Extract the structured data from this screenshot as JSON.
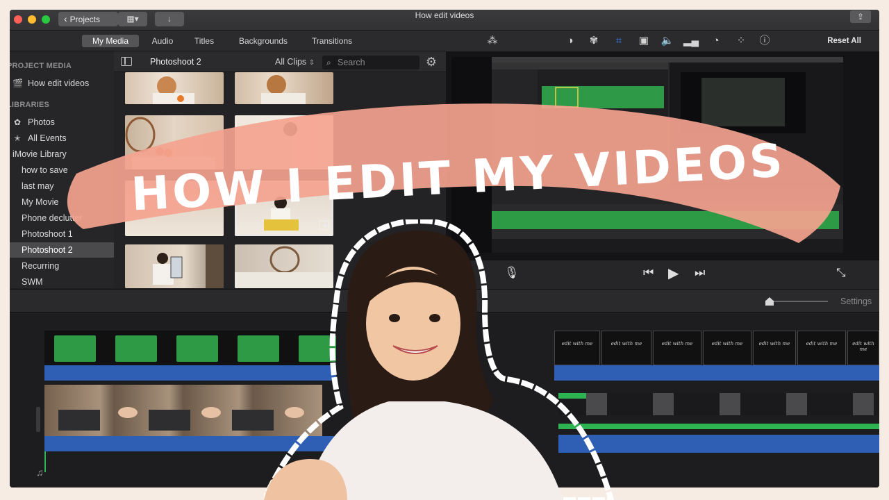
{
  "window": {
    "title": "How edit videos",
    "projects_label": "Projects",
    "colors": {
      "close": "#fe5f57",
      "minimize": "#febc2e",
      "maximize": "#28c840"
    }
  },
  "browser": {
    "tabs": [
      "My Media",
      "Audio",
      "Titles",
      "Backgrounds",
      "Transitions"
    ],
    "active_tab": "My Media",
    "event_title": "Photoshoot 2",
    "filter": "All Clips",
    "search_placeholder": "Search"
  },
  "sidebar": {
    "project_media_heading": "PROJECT MEDIA",
    "project_item": "How edit videos",
    "libraries_heading": "LIBRARIES",
    "items": [
      {
        "label": "Photos",
        "icon": "gear-flower-icon"
      },
      {
        "label": "All Events",
        "icon": "star-icon"
      },
      {
        "label": "iMovie Library",
        "icon": ""
      },
      {
        "label": "how to save",
        "icon": ""
      },
      {
        "label": "last may",
        "icon": ""
      },
      {
        "label": "My Movie",
        "icon": ""
      },
      {
        "label": "Phone declutter",
        "icon": ""
      },
      {
        "label": "Photoshoot 1",
        "icon": ""
      },
      {
        "label": "Photoshoot 2",
        "icon": "",
        "selected": true
      },
      {
        "label": "Recurring",
        "icon": ""
      },
      {
        "label": "SWM",
        "icon": ""
      }
    ]
  },
  "viewer": {
    "reset_label": "Reset All",
    "toolbar_icons": [
      "magic-wand-icon",
      "color-balance-icon",
      "palette-icon",
      "crop-icon",
      "stabilization-icon",
      "volume-icon",
      "equalizer-icon",
      "speed-icon",
      "filter-icon",
      "info-icon"
    ]
  },
  "timeline": {
    "settings_label": "Settings",
    "title_clip_text": "edit with me"
  },
  "overlay": {
    "headline": "HOW I EDIT MY VIDEOS",
    "brush_color": "#f4a38f"
  }
}
